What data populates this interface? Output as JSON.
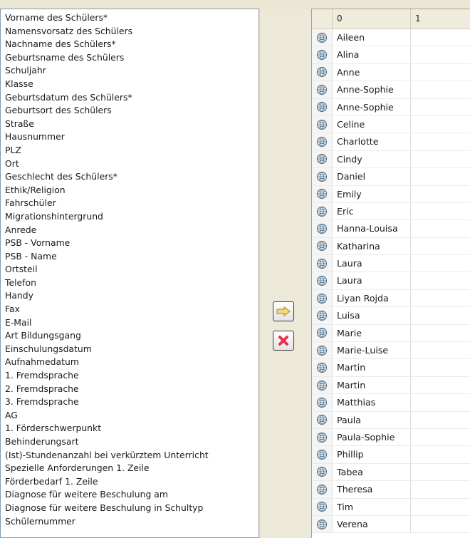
{
  "fields": [
    "Vorname des Schülers*",
    "Namensvorsatz des Schülers",
    "Nachname des Schülers*",
    "Geburtsname des Schülers",
    "Schuljahr",
    "Klasse",
    "Geburtsdatum des Schülers*",
    "Geburtsort des Schülers",
    "Straße",
    "Hausnummer",
    "PLZ",
    "Ort",
    "Geschlecht des Schülers*",
    "Ethik/Religion",
    "Fahrschüler",
    "Migrationshintergrund",
    "Anrede",
    "PSB - Vorname",
    "PSB - Name",
    "Ortsteil",
    "Telefon",
    "Handy",
    "Fax",
    "E-Mail",
    "Art Bildungsgang",
    "Einschulungsdatum",
    "Aufnahmedatum",
    "1. Fremdsprache",
    "2. Fremdsprache",
    "3. Fremdsprache",
    "AG",
    "1. Förderschwerpunkt",
    "Behinderungsart",
    "(Ist)-Stundenanzahl bei verkürztem Unterricht",
    "Spezielle Anforderungen 1. Zeile",
    "Förderbedarf 1. Zeile",
    "Diagnose für weitere Beschulung am",
    "Diagnose für weitere Beschulung in Schultyp",
    "Schülernummer"
  ],
  "buttons": {
    "assign_icon": "arrow-right-icon",
    "remove_icon": "red-x-icon"
  },
  "grid": {
    "columns": [
      "0",
      "1"
    ],
    "row_icon": "globe-icon",
    "rows": [
      "Aileen",
      "Alina",
      "Anne",
      "Anne-Sophie",
      "Anne-Sophie",
      "Celine",
      "Charlotte",
      "Cindy",
      "Daniel",
      "Emily",
      "Eric",
      "Hanna-Louisa",
      "Katharina",
      "Laura",
      "Laura",
      "Liyan Rojda",
      "Luisa",
      "Marie",
      "Marie-Luise",
      "Martin",
      "Martin",
      "Matthias",
      "Paula",
      "Paula-Sophie",
      "Phillip",
      "Tabea",
      "Theresa",
      "Tim",
      "Verena"
    ]
  }
}
